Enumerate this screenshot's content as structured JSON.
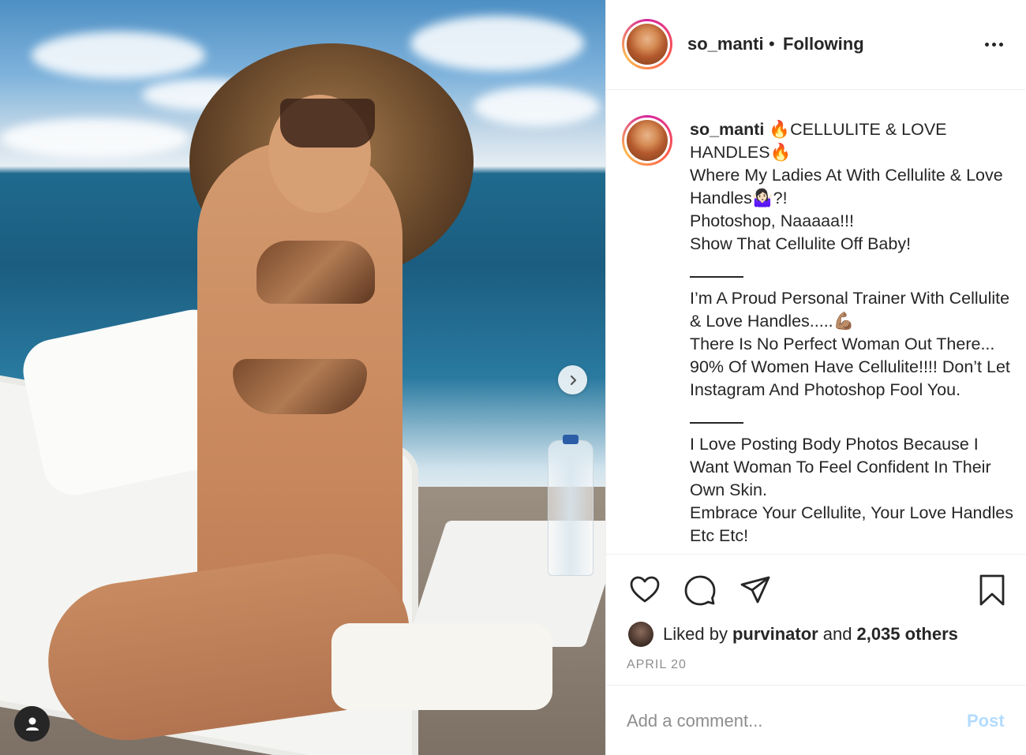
{
  "post": {
    "username": "so_manti",
    "separator": "•",
    "follow_status": "Following"
  },
  "caption": {
    "username": "so_manti",
    "lines": [
      "🔥CELLULITE & LOVE HANDLES🔥",
      "Where My Ladies At With Cellulite & Love Handles🤷🏻‍♀️?!",
      "Photoshop, Naaaaa!!!",
      "Show That Cellulite Off Baby!",
      "I’m A Proud Personal Trainer With Cellulite & Love Handles.....💪🏽",
      "There Is No Perfect Woman Out There...",
      "90% Of Women Have Cellulite!!!! Don’t Let Instagram And Photoshop Fool You.",
      "I Love Posting Body Photos Because I Want Woman To Feel Confident In Their Own Skin.",
      "Embrace Your Cellulite, Your Love Handles Etc Etc!"
    ]
  },
  "likes": {
    "prefix": "Liked by",
    "liker": "purvinator",
    "joiner": "and",
    "others": "2,035 others"
  },
  "date": "APRIL 20",
  "comment": {
    "placeholder": "Add a comment...",
    "post_label": "Post"
  },
  "icons": {
    "more": "more-options-icon",
    "like": "heart-icon",
    "comment": "comment-bubble-icon",
    "share": "paper-plane-icon",
    "save": "bookmark-icon",
    "next": "chevron-right-icon",
    "tag": "user-tag-icon"
  },
  "colors": {
    "text": "#262626",
    "secondary": "#8e8e8e",
    "post_disabled": "#b3dbff",
    "divider": "#efefef"
  }
}
